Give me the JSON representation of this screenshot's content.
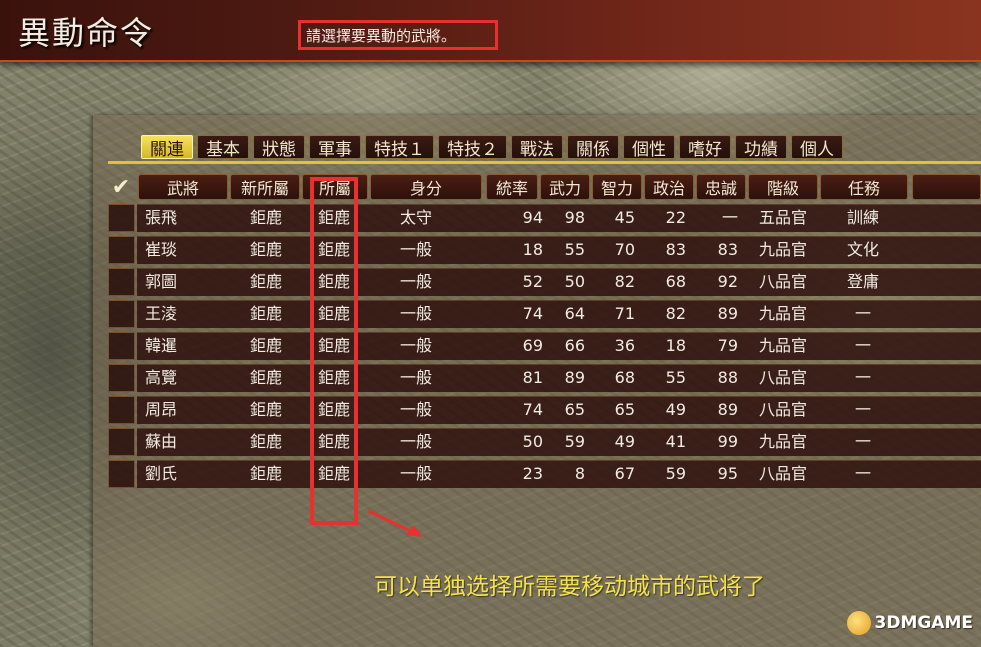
{
  "window": {
    "title": "異動命令",
    "prompt": "請選擇要異動的武將。"
  },
  "tabs": [
    {
      "label": "關連",
      "active": true
    },
    {
      "label": "基本",
      "active": false
    },
    {
      "label": "狀態",
      "active": false
    },
    {
      "label": "軍事",
      "active": false
    },
    {
      "label": "特技１",
      "active": false
    },
    {
      "label": "特技２",
      "active": false
    },
    {
      "label": "戰法",
      "active": false
    },
    {
      "label": "關係",
      "active": false
    },
    {
      "label": "個性",
      "active": false
    },
    {
      "label": "嗜好",
      "active": false
    },
    {
      "label": "功績",
      "active": false
    },
    {
      "label": "個人",
      "active": false
    }
  ],
  "columns": {
    "check": "✔",
    "name": "武將",
    "new_city": "新所屬",
    "city": "所屬",
    "rank": "身分",
    "leadership": "統率",
    "war": "武力",
    "intelligence": "智力",
    "politics": "政治",
    "loyalty": "忠誠",
    "grade": "階級",
    "task": "任務"
  },
  "officers": [
    {
      "name": "張飛",
      "new_city": "鉅鹿",
      "city": "鉅鹿",
      "rank": "太守",
      "leadership": "94",
      "war": "98",
      "intelligence": "45",
      "politics": "22",
      "loyalty": "一",
      "grade": "五品官",
      "task": "訓練"
    },
    {
      "name": "崔琰",
      "new_city": "鉅鹿",
      "city": "鉅鹿",
      "rank": "一般",
      "leadership": "18",
      "war": "55",
      "intelligence": "70",
      "politics": "83",
      "loyalty": "83",
      "grade": "九品官",
      "task": "文化"
    },
    {
      "name": "郭圖",
      "new_city": "鉅鹿",
      "city": "鉅鹿",
      "rank": "一般",
      "leadership": "52",
      "war": "50",
      "intelligence": "82",
      "politics": "68",
      "loyalty": "92",
      "grade": "八品官",
      "task": "登庸"
    },
    {
      "name": "王淩",
      "new_city": "鉅鹿",
      "city": "鉅鹿",
      "rank": "一般",
      "leadership": "74",
      "war": "64",
      "intelligence": "71",
      "politics": "82",
      "loyalty": "89",
      "grade": "九品官",
      "task": "一"
    },
    {
      "name": "韓暹",
      "new_city": "鉅鹿",
      "city": "鉅鹿",
      "rank": "一般",
      "leadership": "69",
      "war": "66",
      "intelligence": "36",
      "politics": "18",
      "loyalty": "79",
      "grade": "九品官",
      "task": "一"
    },
    {
      "name": "高覽",
      "new_city": "鉅鹿",
      "city": "鉅鹿",
      "rank": "一般",
      "leadership": "81",
      "war": "89",
      "intelligence": "68",
      "politics": "55",
      "loyalty": "88",
      "grade": "八品官",
      "task": "一"
    },
    {
      "name": "周昂",
      "new_city": "鉅鹿",
      "city": "鉅鹿",
      "rank": "一般",
      "leadership": "74",
      "war": "65",
      "intelligence": "65",
      "politics": "49",
      "loyalty": "89",
      "grade": "八品官",
      "task": "一"
    },
    {
      "name": "蘇由",
      "new_city": "鉅鹿",
      "city": "鉅鹿",
      "rank": "一般",
      "leadership": "50",
      "war": "59",
      "intelligence": "49",
      "politics": "41",
      "loyalty": "99",
      "grade": "九品官",
      "task": "一"
    },
    {
      "name": "劉氏",
      "new_city": "鉅鹿",
      "city": "鉅鹿",
      "rank": "一般",
      "leadership": "23",
      "war": "8",
      "intelligence": "67",
      "politics": "59",
      "loyalty": "95",
      "grade": "八品官",
      "task": "一"
    }
  ],
  "annotation": {
    "caption": "可以单独选择所需要移动城市的武将了",
    "highlight_color": "#e83030",
    "caption_color": "#f5e24a"
  },
  "watermark": {
    "text": "3DMGAME"
  },
  "colors": {
    "title_bar": "#4d1a12",
    "tab_active": "#e4c236",
    "row_bg": "#2c0e0a",
    "text": "#f1ebe2"
  }
}
